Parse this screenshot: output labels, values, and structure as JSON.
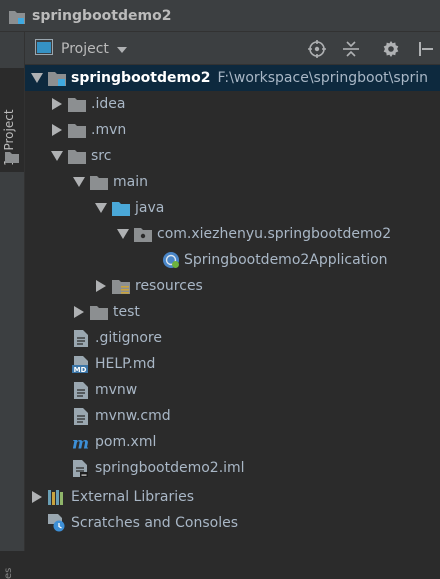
{
  "window": {
    "title": "springbootdemo2"
  },
  "left_strip": {
    "project_tab": "1: Project",
    "bottom_tab": "es"
  },
  "toolbar": {
    "view_label": "Project",
    "icons": [
      "locate-icon",
      "collapse-icon",
      "gear-icon",
      "hide-icon"
    ]
  },
  "tree": {
    "root": {
      "label": "springbootdemo2",
      "path": "F:\\workspace\\springboot\\sprin"
    },
    "items": [
      {
        "label": ".idea"
      },
      {
        "label": ".mvn"
      },
      {
        "label": "src"
      },
      {
        "label": "main"
      },
      {
        "label": "java"
      },
      {
        "label": "com.xiezhenyu.springbootdemo2"
      },
      {
        "label": "Springbootdemo2Application"
      },
      {
        "label": "resources"
      },
      {
        "label": "test"
      },
      {
        "label": ".gitignore"
      },
      {
        "label": "HELP.md"
      },
      {
        "label": "mvnw"
      },
      {
        "label": "mvnw.cmd"
      },
      {
        "label": "pom.xml"
      },
      {
        "label": "springbootdemo2.iml"
      },
      {
        "label": "External Libraries"
      },
      {
        "label": "Scratches and Consoles"
      }
    ]
  },
  "colors": {
    "background": "#2b2b2b",
    "panel": "#3c3f41",
    "selection": "#0d293e",
    "text": "#a9b7c6",
    "folder": "#8c8f91",
    "source_folder": "#4aa8d8",
    "module_accent": "#40a9e0"
  }
}
